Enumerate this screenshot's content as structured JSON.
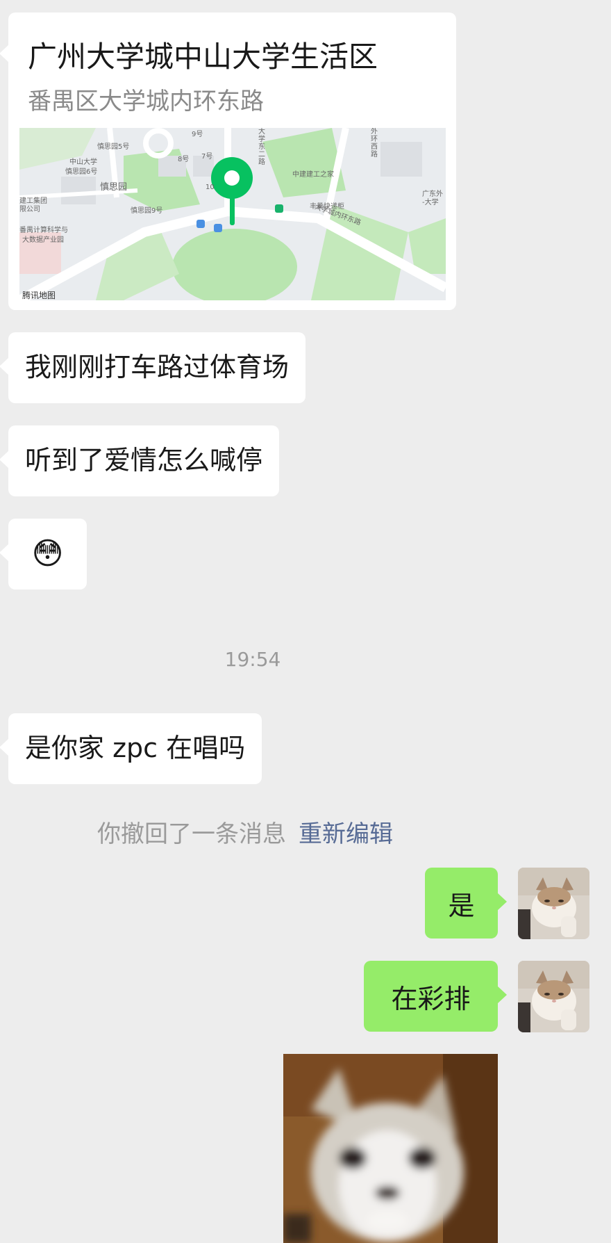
{
  "location_card": {
    "title": "广州大学城中山大学生活区",
    "address": "番禺区大学城内环东路",
    "map_labels": {
      "l1": "慎思园5号",
      "l2": "中山大学",
      "l3": "慎思园6号",
      "l4": "慎思园",
      "l5": "慎思园9号",
      "l6": "8号",
      "l7": "7号",
      "l8": "10",
      "l9": "大学城内环东路",
      "l10": "中建建工之家",
      "l11": "丰巢快递柜",
      "l12": "外环西路",
      "l13": "大学东二路",
      "l14": "广东外",
      "l15": "-大学",
      "l16": "建工集团",
      "l17": "限公司",
      "l18": "番禺计算科学与",
      "l19": "大数据产业园",
      "l20": "9号"
    },
    "map_brand": "腾讯地图"
  },
  "messages": {
    "m1": "我刚刚打车路过体育场",
    "m2": "听到了爱情怎么喊停",
    "m3": "😳",
    "m4": "是你家 zpc 在唱吗",
    "m5": "是",
    "m6": "在彩排"
  },
  "time_separator": "19:54",
  "recall_notice": {
    "text": "你撤回了一条消息",
    "action": "重新编辑"
  },
  "colors": {
    "background": "#ededed",
    "incoming_bubble": "#ffffff",
    "outgoing_bubble": "#95ec69",
    "link": "#576b95",
    "map_pin": "#07c160"
  }
}
